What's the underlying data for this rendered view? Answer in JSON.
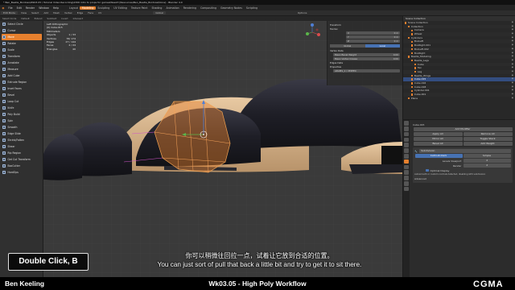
{
  "window": {
    "title": "* Ben_Beetle_Bordoss\\Wk03.05 \\ Tutorial Video Recording\\2306 intro to props for games\\Week3 [Resources\\Ben_Beetle_Bordoss\\Done] - Blender 4.0"
  },
  "menubar": {
    "menus": [
      "File",
      "Edit",
      "Render",
      "Window",
      "Help"
    ],
    "workspaces": [
      "Layout",
      "Modeling",
      "Sculpting",
      "UV Editing",
      "Texture Paint",
      "Shading",
      "Animation",
      "Rendering",
      "Compositing",
      "Geometry Nodes",
      "Scripting"
    ],
    "active_workspace": "Modeling"
  },
  "header": {
    "mode": "Edit Mode",
    "items": [
      "View",
      "Select",
      "Add",
      "Mesh",
      "Vertex",
      "Edge",
      "Face",
      "UV"
    ],
    "transform": "Global",
    "options": "Options"
  },
  "header3": {
    "items": [
      "Select Circle",
      "Default",
      "Extend",
      "Subtract",
      "Invert",
      "Intersect"
    ]
  },
  "toolshelf": {
    "tools": [
      {
        "label": "Select Circle",
        "active": false
      },
      {
        "label": "Cursor",
        "active": false
      },
      {
        "label": "Move",
        "active": true
      },
      {
        "label": "Rotate",
        "active": false
      },
      {
        "label": "Scale",
        "active": false
      },
      {
        "label": "Transform",
        "active": false
      },
      {
        "label": "Annotate",
        "active": false
      },
      {
        "label": "Measure",
        "active": false
      },
      {
        "label": "Add Cube",
        "active": false
      },
      {
        "label": "Extrude Region",
        "active": false
      },
      {
        "label": "Inset Faces",
        "active": false
      },
      {
        "label": "Bevel",
        "active": false
      },
      {
        "label": "Loop Cut",
        "active": false
      },
      {
        "label": "Knife",
        "active": false
      },
      {
        "label": "Poly Build",
        "active": false
      },
      {
        "label": "Spin",
        "active": false
      },
      {
        "label": "Smooth",
        "active": false
      },
      {
        "label": "Edge Slide",
        "active": false
      },
      {
        "label": "Shrink/Fatten",
        "active": false
      },
      {
        "label": "Shear",
        "active": false
      },
      {
        "label": "Rip Region",
        "active": false
      },
      {
        "label": "Get Cut Transform",
        "active": false
      },
      {
        "label": "BoxCutter",
        "active": false
      },
      {
        "label": "HardOps",
        "active": false
      }
    ]
  },
  "viewport": {
    "stats": {
      "view": "Left Orthographic",
      "object": "(0) Cube.015",
      "units": "Millimeters",
      "rows": [
        {
          "label": "Objects",
          "value": "1 / 33"
        },
        {
          "label": "Vertices",
          "value": "76/ 174"
        },
        {
          "label": "Edges",
          "value": "27 / 144"
        },
        {
          "label": "Faces",
          "value": "4 / 24"
        },
        {
          "label": "Triangles",
          "value": "40"
        }
      ]
    },
    "npanel": {
      "title": "Transform",
      "median_label": "Median",
      "fields": [
        {
          "axis": "X",
          "value": "0 m"
        },
        {
          "axis": "Y",
          "value": "0 m"
        },
        {
          "axis": "Z",
          "value": "0 m"
        }
      ],
      "space": [
        "Global",
        "Local"
      ],
      "active_space": "Local",
      "section2": "Vertex Data",
      "vdata": [
        {
          "label": "Mean Bevel Weight",
          "value": "0.00"
        },
        {
          "label": "Mean Vertex Crease",
          "value": "0.00"
        }
      ],
      "section3": "Edges Data",
      "section4": "Properties",
      "prop_label": "ADAMS_1 / VERTEX"
    }
  },
  "outliner": {
    "header": "Scene Collection",
    "rows": [
      {
        "label": "Scene Collection",
        "indent": 0,
        "sel": false
      },
      {
        "label": "Collection",
        "indent": 1,
        "sel": false
      },
      {
        "label": "Camera",
        "indent": 2,
        "sel": false
      },
      {
        "label": "Wheel",
        "indent": 2,
        "sel": false
      },
      {
        "label": "Cylinders",
        "indent": 1,
        "sel": false
      },
      {
        "label": "BoxLeft",
        "indent": 2,
        "sel": false
      },
      {
        "label": "BoxRight.001",
        "indent": 2,
        "sel": false
      },
      {
        "label": "BoxLeft.002",
        "indent": 2,
        "sel": false
      },
      {
        "label": "BoxRight",
        "indent": 2,
        "sel": false
      },
      {
        "label": "Beetle_Modeling",
        "indent": 1,
        "sel": false
      },
      {
        "label": "Beetle_Legs",
        "indent": 2,
        "sel": false
      },
      {
        "label": "Cube",
        "indent": 3,
        "sel": false
      },
      {
        "label": "Tex",
        "indent": 3,
        "sel": false
      },
      {
        "label": "Leg",
        "indent": 3,
        "sel": false
      },
      {
        "label": "Beetle_Wings",
        "indent": 2,
        "sel": false
      },
      {
        "label": "Cube.015",
        "indent": 2,
        "sel": true
      },
      {
        "label": "Cube.016",
        "indent": 2,
        "sel": false
      },
      {
        "label": "Cube.018",
        "indent": 2,
        "sel": false
      },
      {
        "label": "Cylinder.001",
        "indent": 2,
        "sel": false
      },
      {
        "label": "Cube.001",
        "indent": 2,
        "sel": false
      },
      {
        "label": "Plane",
        "indent": 1,
        "sel": false
      }
    ]
  },
  "properties": {
    "object": "Cube.015",
    "add_modifier": "Add Modifier",
    "row1": [
      "Apply All",
      "Remove All"
    ],
    "row2": [
      "Mirror All",
      "Toggle Stack"
    ],
    "row3": [
      "Bevel All",
      "Add Weight"
    ],
    "modifier_name": "Subdivision",
    "mode": [
      "Catmull-Clark",
      "Simple"
    ],
    "active_mode": "Catmull-Clark",
    "levels_viewport": "Levels Viewport",
    "levels_value": "2",
    "render_label": "Render",
    "render_value": "2",
    "optimal": "Optimal Display",
    "note": "Autosmooth or custom normals detected, disabling GPU subdivision",
    "advanced": "Advanced"
  },
  "overlay": {
    "shortcut": "Double Click, B",
    "subtitle_zh": "你可以稍微往回拉一点，试着让它放到合适的位置。",
    "subtitle_en": "You can just sort of pull that back a little bit and try to get it to sit there.",
    "presenter": "Ben Keeling",
    "course": "Wk03.05 - High Poly Workflow",
    "logo": "CGMA"
  },
  "colors": {
    "accent": "#e6802e",
    "select_blue": "#4772b3",
    "body": "#1c1c24",
    "chassis": "#d7b48c",
    "overlay_bg": "#000000"
  }
}
